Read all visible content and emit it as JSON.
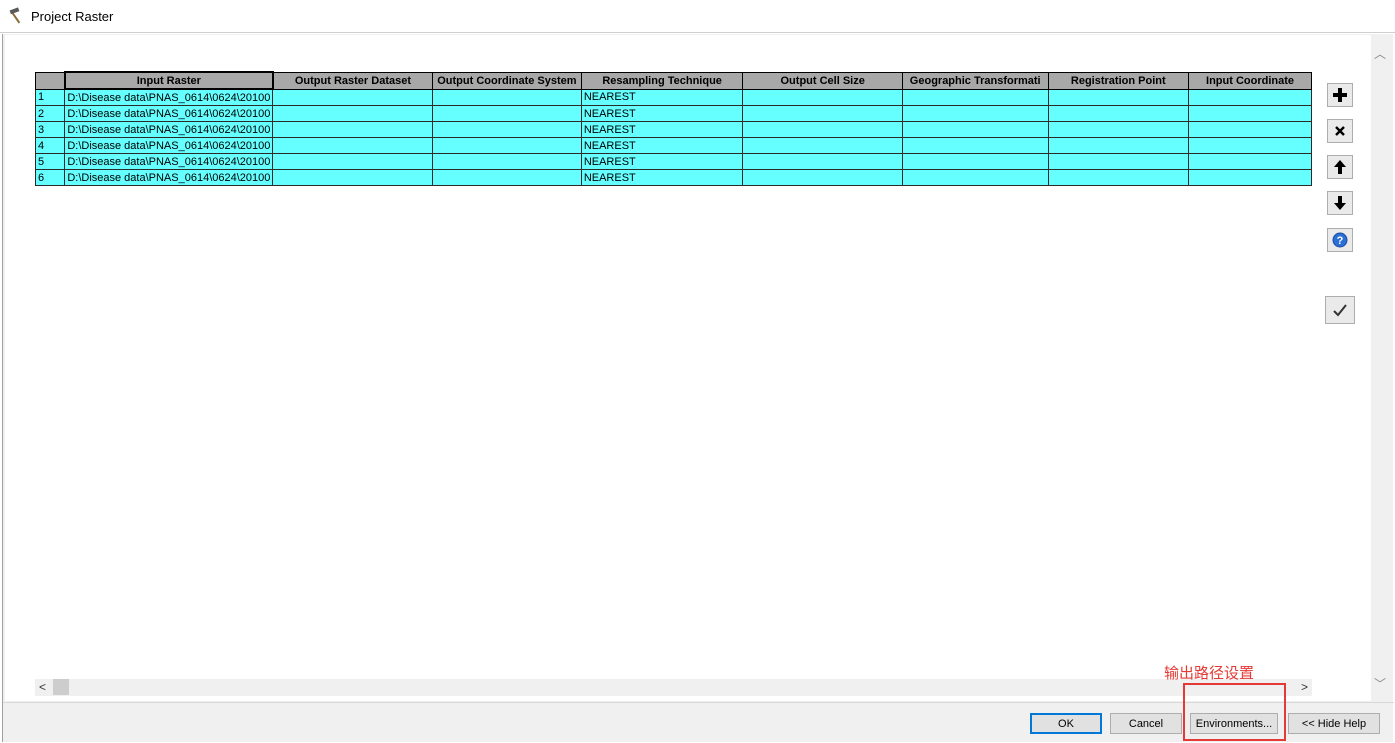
{
  "window": {
    "title": "Project Raster",
    "icon": "hammer-icon"
  },
  "grid": {
    "columns": [
      "Input Raster",
      "Output Raster Dataset",
      "Output Coordinate System",
      "Resampling Technique",
      "Output Cell Size",
      "Geographic Transformati",
      "Registration Point",
      "Input Coordinate"
    ],
    "rows": [
      {
        "num": "1",
        "input": "D:\\Disease data\\PNAS_0614\\0624\\20100",
        "output": "",
        "coord": "",
        "resampling": "NEAREST",
        "cellsize": "",
        "geo": "",
        "reg": "",
        "incoord": ""
      },
      {
        "num": "2",
        "input": "D:\\Disease data\\PNAS_0614\\0624\\20100",
        "output": "",
        "coord": "",
        "resampling": "NEAREST",
        "cellsize": "",
        "geo": "",
        "reg": "",
        "incoord": ""
      },
      {
        "num": "3",
        "input": "D:\\Disease data\\PNAS_0614\\0624\\20100",
        "output": "",
        "coord": "",
        "resampling": "NEAREST",
        "cellsize": "",
        "geo": "",
        "reg": "",
        "incoord": ""
      },
      {
        "num": "4",
        "input": "D:\\Disease data\\PNAS_0614\\0624\\20100",
        "output": "",
        "coord": "",
        "resampling": "NEAREST",
        "cellsize": "",
        "geo": "",
        "reg": "",
        "incoord": ""
      },
      {
        "num": "5",
        "input": "D:\\Disease data\\PNAS_0614\\0624\\20100",
        "output": "",
        "coord": "",
        "resampling": "NEAREST",
        "cellsize": "",
        "geo": "",
        "reg": "",
        "incoord": ""
      },
      {
        "num": "6",
        "input": "D:\\Disease data\\PNAS_0614\\0624\\20100",
        "output": "",
        "coord": "",
        "resampling": "NEAREST",
        "cellsize": "",
        "geo": "",
        "reg": "",
        "incoord": ""
      }
    ],
    "cell_color": "#66ffff",
    "header_color": "#a8a8a8"
  },
  "side_buttons": {
    "add_icon": "plus-icon",
    "remove_icon": "close-icon",
    "up_icon": "arrow-up-icon",
    "down_icon": "arrow-down-icon",
    "help_icon": "help-icon",
    "check_icon": "check-icon"
  },
  "annotation": {
    "text": "输出路径设置",
    "color": "#e53935"
  },
  "footer": {
    "ok": "OK",
    "cancel": "Cancel",
    "environments": "Environments...",
    "hide_help": "<< Hide Help"
  }
}
